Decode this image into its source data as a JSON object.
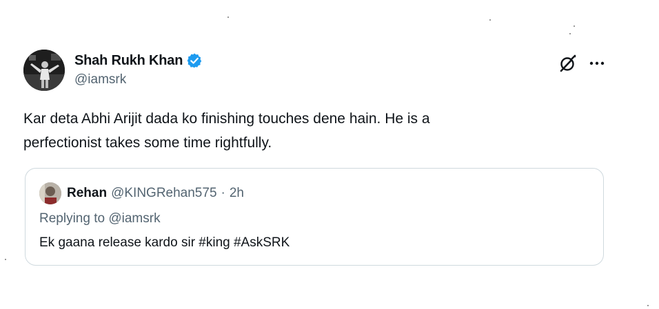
{
  "tweet": {
    "author": {
      "display_name": "Shah Rukh Khan",
      "handle": "@iamsrk",
      "verified": true,
      "avatar_icon": "profile-photo"
    },
    "text_line1": "Kar deta Abhi Arijit dada ko finishing touches dene hain. He is a",
    "text_line2": "perfectionist takes some time rightfully.",
    "actions": {
      "grok_icon": "grok-icon",
      "more_icon": "more-icon"
    }
  },
  "quoted_tweet": {
    "author": {
      "display_name": "Rehan",
      "handle": "@KINGRehan575",
      "separator": "·",
      "time": "2h"
    },
    "replying_to": "Replying to @iamsrk",
    "text": "Ek gaana release kardo sir #king #AskSRK"
  },
  "colors": {
    "primary_text": "#0f1419",
    "secondary_text": "#536471",
    "verified_blue": "#1d9bf0",
    "card_border": "#cfd9de"
  }
}
